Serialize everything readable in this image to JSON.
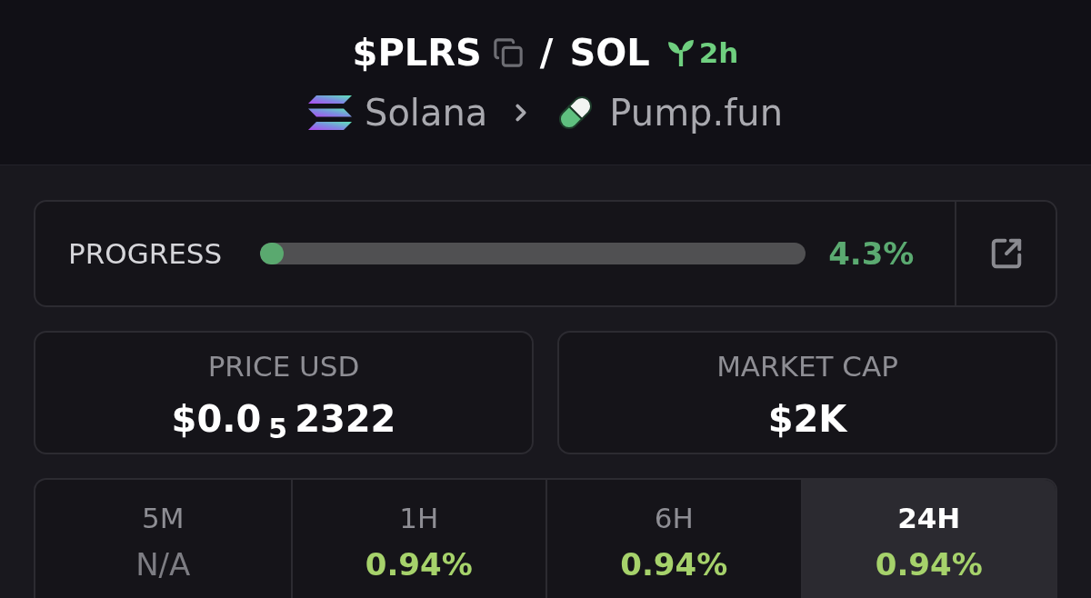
{
  "header": {
    "token": "$PLRS",
    "separator": "/",
    "quote": "SOL",
    "age": "2h",
    "breadcrumb": [
      {
        "label": "Solana",
        "kind": "chain"
      },
      {
        "label": "Pump.fun",
        "kind": "launchpad"
      }
    ]
  },
  "progress": {
    "label": "PROGRESS",
    "level": 0.043,
    "reading": "4.3%"
  },
  "stats": [
    {
      "label": "PRICE USD",
      "value": "$0.0$_{5}$2322"
    },
    {
      "label": "MARKET CAP",
      "value": "$2K"
    }
  ],
  "timeframes": [
    {
      "label": "5M",
      "value": "N/A",
      "kind": "missing",
      "selected": false
    },
    {
      "label": "1H",
      "value": "0.94%",
      "kind": "change",
      "selected": false
    },
    {
      "label": "6H",
      "value": "0.94%",
      "kind": "change",
      "selected": false
    },
    {
      "label": "24H",
      "value": "0.94%",
      "kind": "change",
      "selected": true
    }
  ]
}
